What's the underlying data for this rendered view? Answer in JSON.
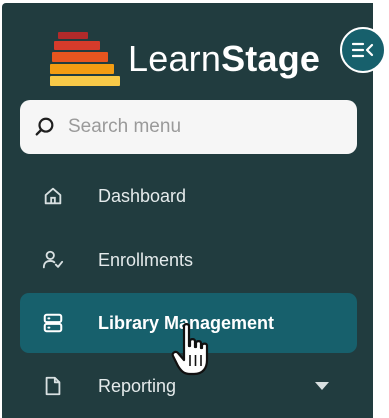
{
  "brand": {
    "name_light": "Learn",
    "name_bold": "Stage",
    "logo_colors": [
      "#c0392b",
      "#e74c3c",
      "#f39c12",
      "#f5b700",
      "#f7c948"
    ]
  },
  "sidebar": {
    "collapse_icon": "collapse-menu-icon",
    "search": {
      "placeholder": "Search menu",
      "icon": "search-icon"
    },
    "items": [
      {
        "label": "Dashboard",
        "icon": "home-icon",
        "active": false
      },
      {
        "label": "Enrollments",
        "icon": "user-check-icon",
        "active": false
      },
      {
        "label": "Library Management",
        "icon": "server-icon",
        "active": true
      },
      {
        "label": "Reporting",
        "icon": "file-icon",
        "active": false,
        "has_dropdown": true
      }
    ]
  },
  "colors": {
    "sidebar_bg": "#213c3f",
    "active_bg": "#17606c",
    "accent": "#17606c"
  }
}
